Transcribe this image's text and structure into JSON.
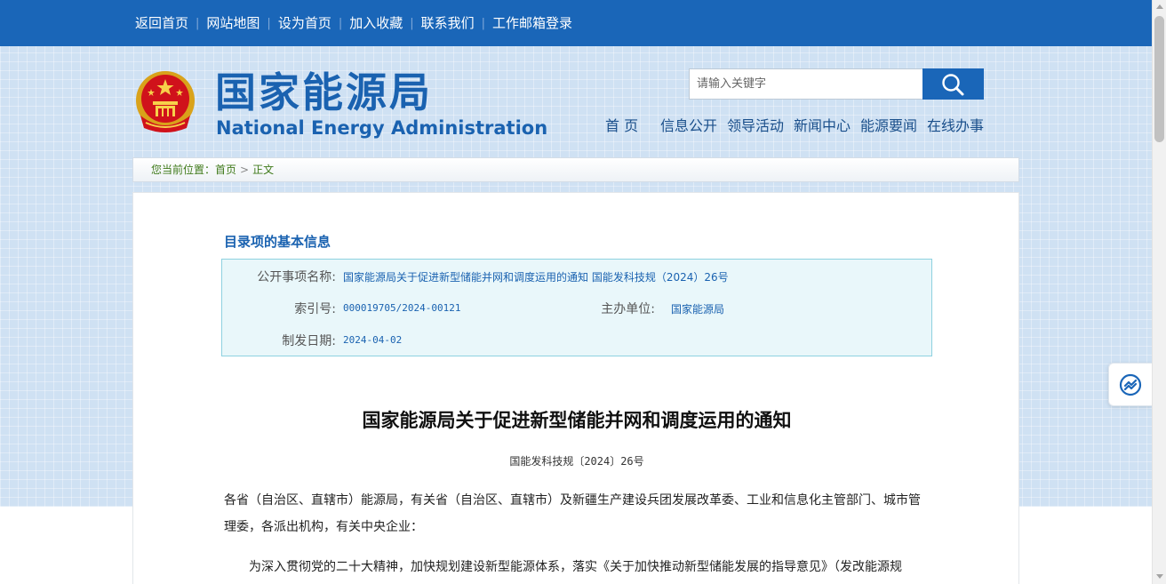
{
  "topbar": {
    "links": [
      "返回首页",
      "网站地图",
      "设为首页",
      "加入收藏",
      "联系我们",
      "工作邮箱登录"
    ],
    "separator": "|"
  },
  "header": {
    "title_cn": "国家能源局",
    "title_en": "National Energy Administration",
    "emblem_icon": "national-emblem-icon"
  },
  "search": {
    "placeholder": "请输入关键字",
    "button_icon": "search-icon"
  },
  "nav": {
    "home": "首  页",
    "info": "信息公开",
    "leaders": "领导活动",
    "news": "新闻中心",
    "energy": "能源要闻",
    "service": "在线办事"
  },
  "breadcrumb": {
    "prefix": "您当前位置：",
    "home": "首页",
    "arrow": ">",
    "current": "正文"
  },
  "catalog": {
    "section_title": "目录项的基本信息",
    "name_label": "公开事项名称:",
    "name_value": "国家能源局关于促进新型储能并网和调度运用的通知 国能发科技规（2024）26号",
    "index_label": "索引号:",
    "index_value": "000019705/2024-00121",
    "org_label": "主办单位:",
    "org_value": "国家能源局",
    "date_label": "制发日期:",
    "date_value": "2024-04-02"
  },
  "article": {
    "title": "国家能源局关于促进新型储能并网和调度运用的通知",
    "doc_number": "国能发科技规〔2024〕26号",
    "para1_line1": "各省（自治区、直辖市）能源局，有关省（自治区、直辖市）及新疆生产建设兵团发展改革委、工业和信息化主管部门、城市管",
    "para1_line2": "理委，各派出机构，有关中央企业：",
    "para2_line1": "为深入贯彻党的二十大精神，加快规划建设新型能源体系，落实《关于加快推动新型储能发展的指导意见》（发改能源规"
  },
  "colors": {
    "topbar": "#1a66b8",
    "brand_blue": "#1a62b0",
    "breadcrumb_green": "#3f7a1a",
    "info_box_bg": "#e9f7fa",
    "info_box_border": "#8ed1e0"
  },
  "float_widget": {
    "icon": "assistant-icon"
  }
}
